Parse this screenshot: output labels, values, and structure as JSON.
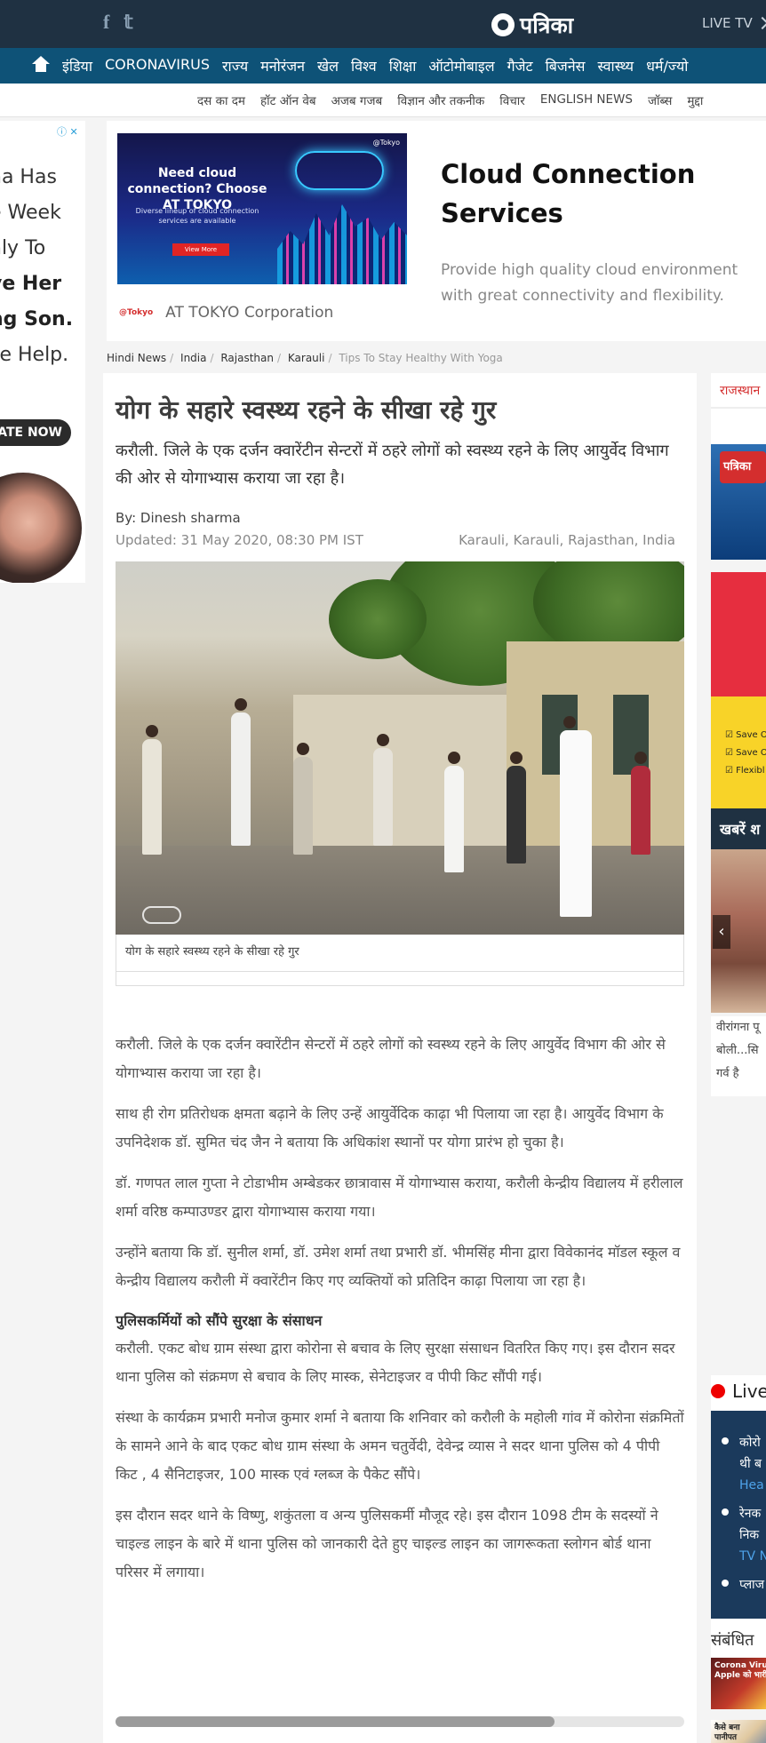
{
  "header": {
    "social": [
      "f",
      "𝕥"
    ],
    "logo_text": "पत्रिका",
    "live_tv": "LIVE TV"
  },
  "nav": {
    "items": [
      "इंडिया",
      "CORONAVIRUS",
      "राज्य",
      "मनोरंजन",
      "खेल",
      "विश्व",
      "शिक्षा",
      "ऑटोमोबाइल",
      "गैजेट",
      "बिजनेस",
      "स्वास्थ्य",
      "धर्म/ज्यो"
    ]
  },
  "subnav": {
    "items": [
      "दस का दम",
      "हॉट ऑन वेब",
      "अजब गजब",
      "विज्ञान और तकनीक",
      "विचार",
      "ENGLISH NEWS",
      "जॉब्स",
      "मुद्दा"
    ]
  },
  "left_ad": {
    "ad_choice": "ⓘ ✕",
    "lines": [
      "na Has",
      "e Week",
      "nly To",
      "ve Her",
      "ng Son.",
      "se Help."
    ],
    "cta": "ATE NOW"
  },
  "top_ad": {
    "image_heading": "Need cloud connection? Choose AT TOKYO",
    "image_sub": "Diverse lineup of cloud connection services are available",
    "image_button": "View More",
    "image_brand": "@Tokyo",
    "brand_small": "@Tokyo",
    "brand_name": "AT TOKYO Corporation",
    "title": "Cloud Connection Services",
    "description": "Provide high quality cloud environment with great connectivity and flexibility."
  },
  "breadcrumb": {
    "items": [
      "Hindi News",
      "India",
      "Rajasthan",
      "Karauli"
    ],
    "current": "Tips To Stay Healthy With Yoga"
  },
  "article": {
    "headline": "योग के सहारे स्वस्थ्य रहने के सीखा रहे गुर",
    "summary": "करौली. जिले के एक दर्जन क्वारेंटीन सेन्टरों में ठहरे लोगों को स्वस्थ्य रहने के लिए आयुर्वेद विभाग की ओर से योगाभ्यास कराया जा रहा है।",
    "byline": "By: Dinesh sharma",
    "updated": "Updated: 31 May 2020, 08:30 PM IST",
    "location": "Karauli, Karauli, Rajasthan, India",
    "photo_caption": "योग के सहारे स्वस्थ्य रहने के सीखा रहे गुर",
    "paragraphs": [
      "करौली. जिले के एक दर्जन क्वारेंटीन सेन्टरों में ठहरे लोगों को स्वस्थ्य रहने के लिए आयुर्वेद विभाग की ओर से योगाभ्यास कराया जा रहा है।",
      "साथ ही रोग प्रतिरोधक क्षमता बढ़ाने के लिए उन्हें आयुर्वेदिक काढ़ा भी पिलाया जा रहा है। आयुर्वेद विभाग के उपनिदेशक डॉ. सुमित चंद जैन ने बताया कि अधिकांश स्थानों पर योगा प्रारंभ हो चुका है।",
      "डॉ. गणपत लाल गुप्ता ने टोडाभीम अम्बेडकर छात्रावास में योगाभ्यास कराया, करौली केन्द्रीय विद्यालय में हरीलाल शर्मा वरिष्ठ कम्पाउण्डर द्वारा योगाभ्यास कराया गया।",
      "उन्होंने बताया कि डॉ. सुनील शर्मा, डॉ. उमेश शर्मा तथा प्रभारी डॉ. भीमसिंह मीना द्वारा विवेकानंद मॉडल स्कूल व केन्द्रीय विद्यालय करौली में क्वारेंटीन किए गए व्यक्तियों को प्रतिदिन काढ़ा पिलाया जा रहा है।"
    ],
    "subheading": "पुलिसकर्मियों को सौंपे सुरक्षा के संसाधन",
    "paragraphs2": [
      "करौली. एकट बोध ग्राम संस्था द्वारा कोरोना से बचाव के लिए सुरक्षा संसाधन वितरित किए गए। इस दौरान सदर थाना पुलिस को संक्रमण से बचाव के लिए मास्क, सेनेटाइजर व पीपी किट सौंपी गई।",
      "संस्था के कार्यक्रम प्रभारी मनोज कुमार शर्मा ने बताया कि शनिवार को करौली के महोली गांव में कोरोना संक्रमितों के सामने आने के बाद एकट बोध ग्राम संस्था के अमन चतुर्वेदी, देवेन्द्र व्यास ने सदर थाना पुलिस को 4 पीपी किट , 4 सैनिटाइजर, 100 मास्क एवं ग्लब्ज के पैकेट सौंपे।",
      "इस दौरान सदर थाने के विष्णु, शकुंतला व अन्य पुलिसकर्मी मौजूद रहे। इस दौरान 1098 टीम के सदस्यों ने चाइल्ड लाइन के बारे में थाना पुलिस को जानकारी देते हुए चाइल्ड लाइन का जागरूकता स्लोगन बोर्ड थाना परिसर में लगाया।"
    ]
  },
  "sidebar": {
    "rajasthan_title": "राजस्थान",
    "patrika_logo": "पत्रिका",
    "ad_lines": [
      "☑ Save O",
      "☑ Save O",
      "☑ Flexibl"
    ],
    "khabar_title": "खबरें श",
    "khabar_arrow": "‹",
    "khabar_text": [
      "वीरांगना पू",
      "बोली...सि",
      "गर्व है"
    ],
    "live_title": "Live",
    "live_items": [
      {
        "line1": "कोरो",
        "line2": "थी ब",
        "link": "Hea"
      },
      {
        "line1": "रेनक",
        "line2": "निक",
        "link": "TV N"
      },
      {
        "line1": "प्लाज",
        "line2": "",
        "link": ""
      }
    ],
    "related_title": "संबंधित",
    "thumbs": [
      "Corona Viru\nApple को भारी",
      "कैसे बना\nपानीपत"
    ]
  },
  "colors": {
    "topbar": "#1f3142",
    "nav": "#0e5277",
    "accent_red": "#d42e2e"
  }
}
